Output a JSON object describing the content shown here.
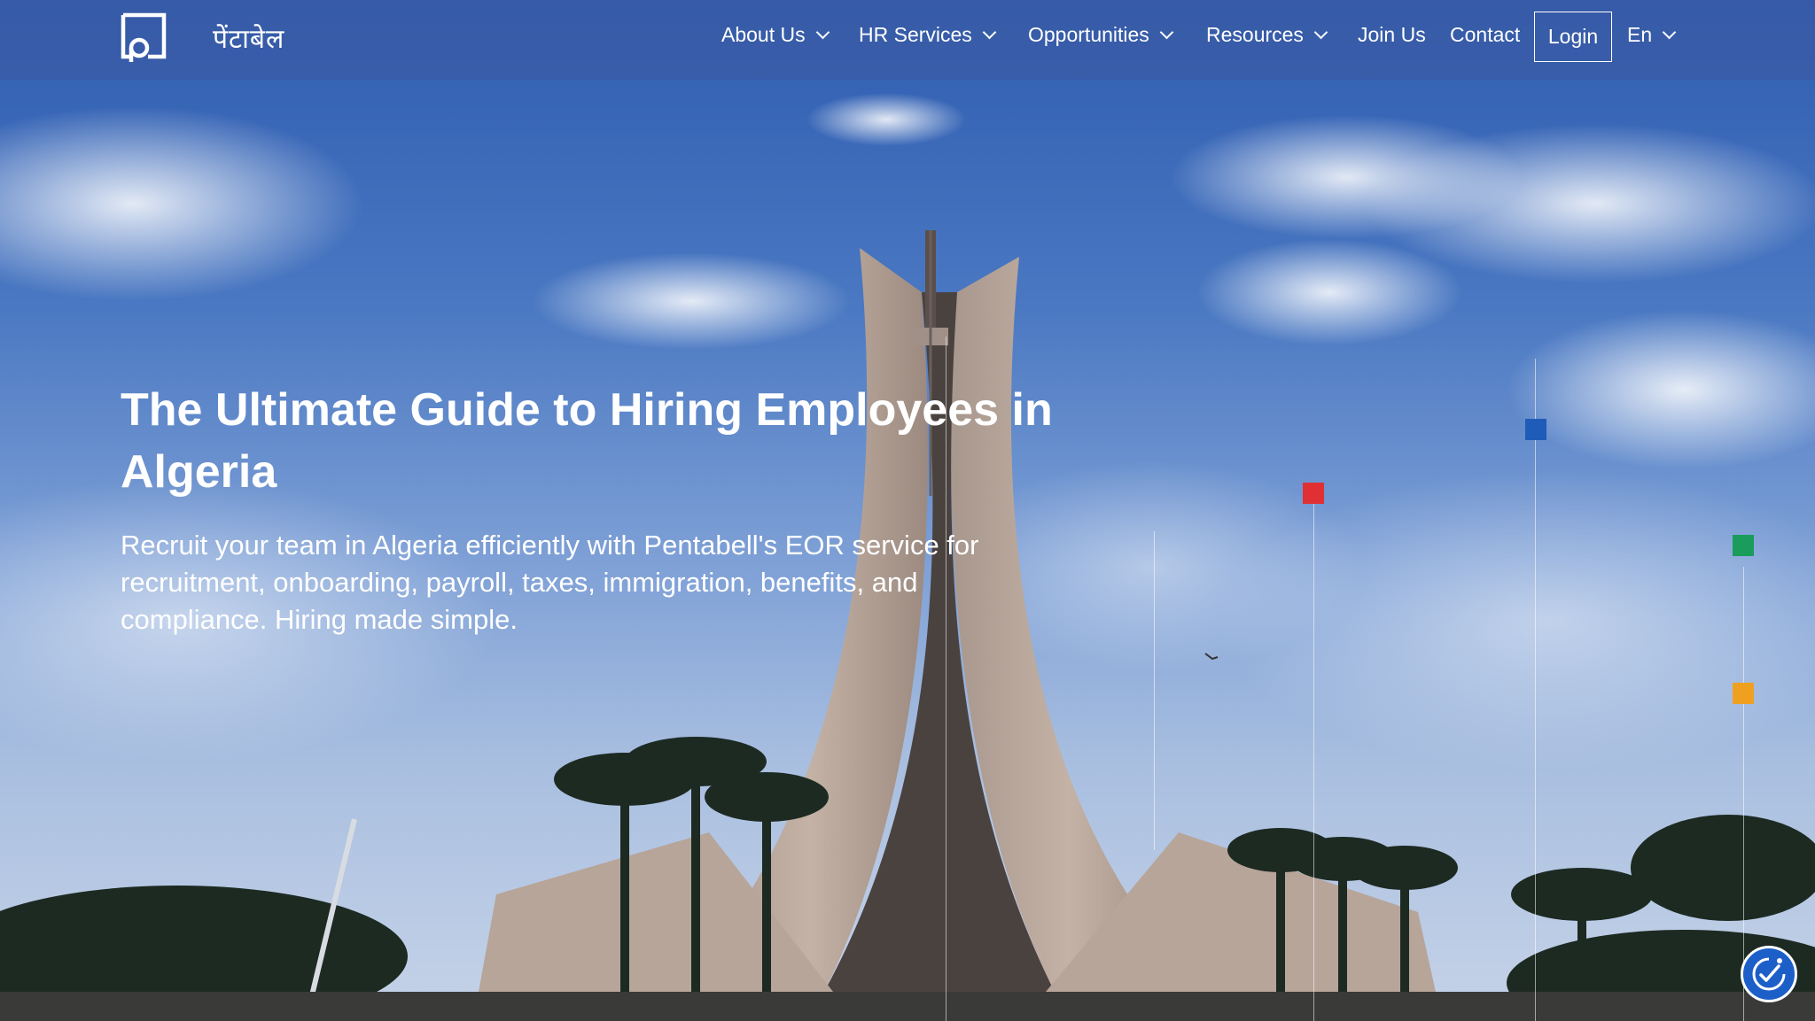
{
  "brand": {
    "logo_text": "पेंटाबेल"
  },
  "nav": {
    "about": "About Us",
    "hr_services": "HR Services",
    "opportunities": "Opportunities",
    "resources": "Resources",
    "join": "Join Us",
    "contact": "Contact",
    "login": "Login",
    "language": "En"
  },
  "hero": {
    "title": "The Ultimate Guide to Hiring Employees in Algeria",
    "subtitle": "Recruit your team in Algeria efficiently with Pentabell's EOR service for recruitment, onboarding, payroll, taxes, immigration, benefits, and compliance. Hiring made simple."
  },
  "colors": {
    "accent_red": "#e03033",
    "accent_blue": "#1f5bb8",
    "accent_green": "#1a9c5c",
    "accent_yellow": "#f0a020"
  },
  "icons": {
    "accessibility": "accessibility-icon"
  }
}
